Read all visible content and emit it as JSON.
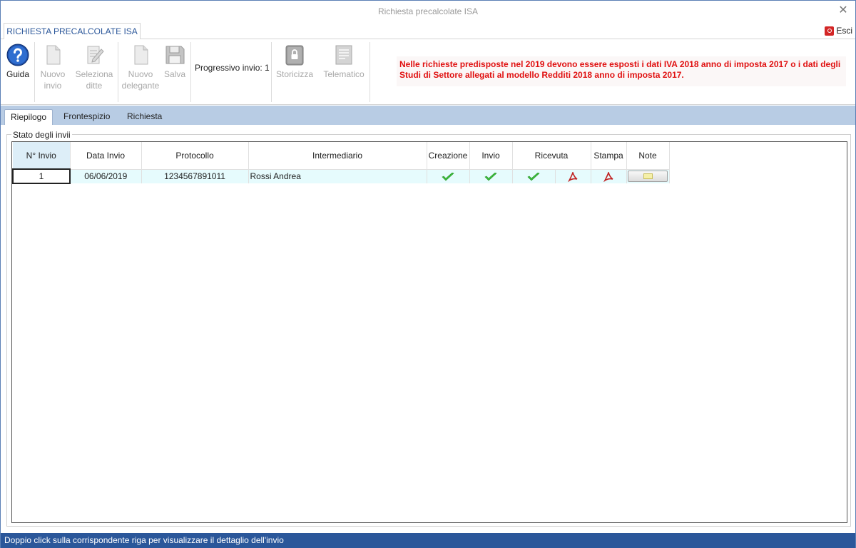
{
  "window": {
    "title": "Richiesta precalcolate ISA",
    "close_glyph": "✕"
  },
  "ribbon_tabs": {
    "active_tab": "RICHIESTA PRECALCOLATE ISA",
    "exit_label": "Esci"
  },
  "ribbon": {
    "guida": "Guida",
    "nuovo_invio_1": "Nuovo",
    "nuovo_invio_2": "invio",
    "seleziona_1": "Seleziona",
    "seleziona_2": "ditte",
    "nuovo_delegante_1": "Nuovo",
    "nuovo_delegante_2": "delegante",
    "salva": "Salva",
    "progressivo": "Progressivo invio: 1",
    "storicizza": "Storicizza",
    "telematico": "Telematico",
    "notice": "Nelle richieste predisposte nel 2019 devono essere esposti i dati IVA 2018 anno di imposta 2017 o i dati degli Studi di Settore allegati al modello Redditi 2018 anno di imposta 2017.",
    "notice_color": "#e01010"
  },
  "subtabs": [
    "Riepilogo",
    "Frontespizio",
    "Richiesta"
  ],
  "group_title": "Stato degli invii",
  "grid": {
    "headers": [
      "N° Invio",
      "Data Invio",
      "Protocollo",
      "Intermediario",
      "Creazione",
      "Invio",
      "Ricevuta",
      "Stampa",
      "Note"
    ],
    "rows": [
      {
        "n_invio": "1",
        "data_invio": "06/06/2019",
        "protocollo": "1234567891011",
        "intermediario": "Rossi Andrea",
        "creazione": "check-icon",
        "invio": "check-icon",
        "ricevuta": "check-icon",
        "ricevuta_pdf": "pdf-icon",
        "stampa": "pdf-icon",
        "note": "note-icon"
      }
    ]
  },
  "statusbar": "Doppio click sulla corrispondente riga per visualizzare il dettaglio dell'invio",
  "colors": {
    "accent": "#2b579a",
    "subtab_bar": "#b8cce4",
    "row_bg": "#e6fbfd"
  }
}
